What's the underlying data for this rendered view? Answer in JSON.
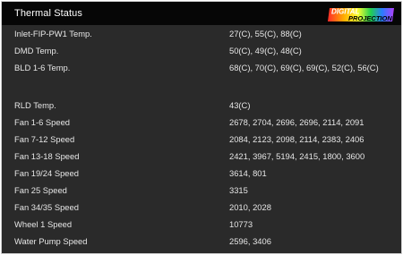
{
  "window": {
    "title": "Thermal Status",
    "brand_logo": {
      "line1": "DIGITAL",
      "line2": "PROJECTION"
    }
  },
  "rows": [
    {
      "label": "Inlet-FIP-PW1 Temp.",
      "value": "27(C), 55(C), 88(C)"
    },
    {
      "label": "DMD Temp.",
      "value": "50(C), 49(C), 48(C)"
    },
    {
      "label": "BLD 1-6 Temp.",
      "value": "68(C), 70(C), 69(C), 69(C), 52(C), 56(C)"
    },
    {
      "label": "",
      "value": ""
    },
    {
      "label": "RLD Temp.",
      "value": "43(C)"
    },
    {
      "label": "Fan 1-6 Speed",
      "value": "2678, 2704, 2696, 2696, 2114, 2091"
    },
    {
      "label": "Fan 7-12 Speed",
      "value": "2084, 2123, 2098, 2114, 2383, 2406"
    },
    {
      "label": "Fan 13-18 Speed",
      "value": "2421, 3967, 5194, 2415, 1800, 3600"
    },
    {
      "label": "Fan 19/24 Speed",
      "value": "3614, 801"
    },
    {
      "label": "Fan 25 Speed",
      "value": "3315"
    },
    {
      "label": "Fan 34/35 Speed",
      "value": "2010, 2028"
    },
    {
      "label": "Wheel 1 Speed",
      "value": "10773"
    },
    {
      "label": "Water Pump Speed",
      "value": "2596, 3406"
    }
  ]
}
